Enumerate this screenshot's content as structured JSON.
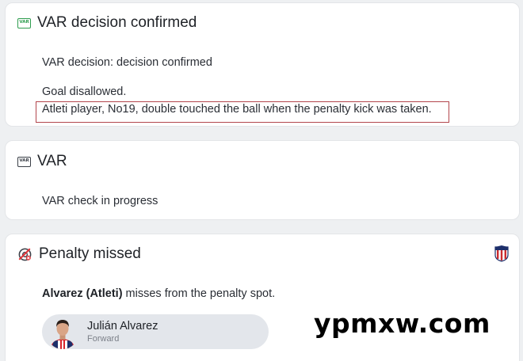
{
  "events": [
    {
      "icon": "var-icon",
      "icon_text": "VAR",
      "icon_color": "#2f9d4f",
      "title": "VAR decision confirmed",
      "lines": [
        "VAR decision: decision confirmed",
        "Goal disallowed.",
        "Atleti player, No19, double touched the ball when the penalty kick was taken."
      ],
      "highlight_color": "#b3464d"
    },
    {
      "icon": "var-icon",
      "icon_text": "VAR",
      "title": "VAR",
      "lines": [
        "VAR check in progress"
      ]
    },
    {
      "icon": "penalty-missed-icon",
      "title": "Penalty missed",
      "description_player": "Alvarez (Atleti)",
      "description_rest": " misses from the penalty spot.",
      "team_badge": "atletico-madrid-crest",
      "player": {
        "name": "Julián Alvarez",
        "position": "Forward"
      }
    }
  ],
  "watermark": "ypmxw.com"
}
